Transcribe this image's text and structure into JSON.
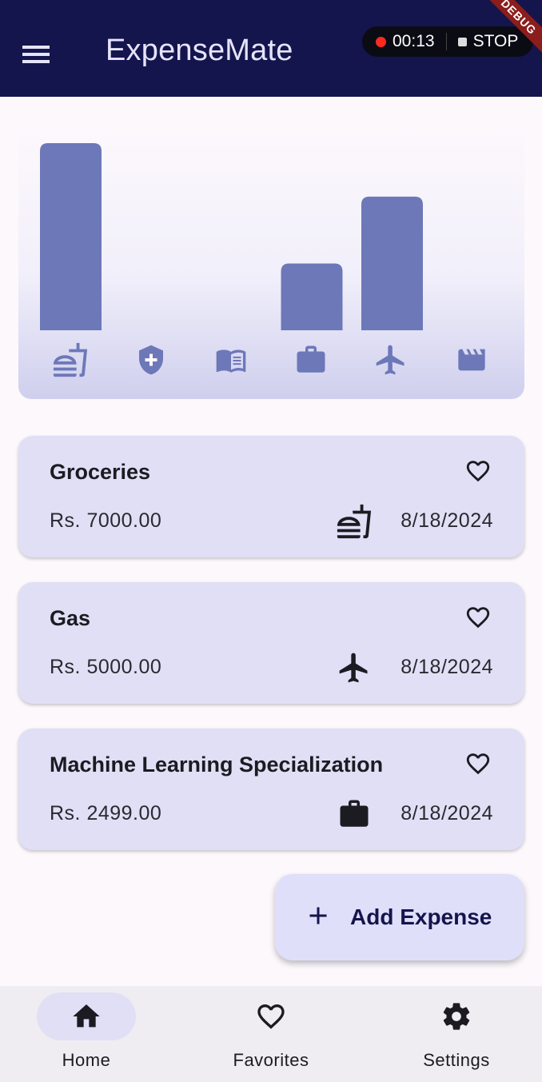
{
  "app": {
    "title": "ExpenseMate"
  },
  "recorder": {
    "time": "00:13",
    "stop_label": "STOP"
  },
  "debug_banner": "DEBUG",
  "colors": {
    "appbar": "#14154d",
    "bar": "#6d78b9",
    "card": "#e1dff5",
    "fab": "#e0dffa"
  },
  "chart_data": {
    "type": "bar",
    "categories": [
      "food",
      "health",
      "education",
      "work",
      "travel",
      "leisure"
    ],
    "category_icons": [
      "fastfood-icon",
      "health-shield-icon",
      "book-icon",
      "briefcase-icon",
      "airplane-icon",
      "movie-clapper-icon"
    ],
    "values": [
      7000,
      0,
      0,
      2499,
      5000,
      0
    ],
    "ylim": [
      0,
      7000
    ],
    "title": "",
    "xlabel": "",
    "ylabel": "",
    "grid": false
  },
  "expenses": [
    {
      "title": "Groceries",
      "amount": "Rs. 7000.00",
      "date": "8/18/2024",
      "category_icon": "fastfood-icon"
    },
    {
      "title": "Gas",
      "amount": "Rs. 5000.00",
      "date": "8/18/2024",
      "category_icon": "airplane-icon"
    },
    {
      "title": "Machine Learning Specialization",
      "amount": "Rs. 2499.00",
      "date": "8/18/2024",
      "category_icon": "briefcase-icon"
    }
  ],
  "fab": {
    "label": "Add Expense"
  },
  "nav": {
    "items": [
      {
        "label": "Home",
        "icon": "home-icon",
        "active": true
      },
      {
        "label": "Favorites",
        "icon": "heart-outline-icon",
        "active": false
      },
      {
        "label": "Settings",
        "icon": "gear-icon",
        "active": false
      }
    ]
  }
}
